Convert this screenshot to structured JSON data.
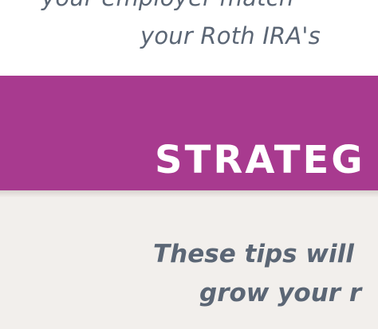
{
  "intro": {
    "line_1": "your employer match",
    "line_2": "your Roth IRA's"
  },
  "banner": {
    "title": "STRATEG"
  },
  "tips": {
    "line_1": "These tips will",
    "line_2": "grow your r"
  },
  "colors": {
    "banner": "#a83a8f",
    "text": "#5b6675",
    "tips_background": "#f2efec"
  }
}
